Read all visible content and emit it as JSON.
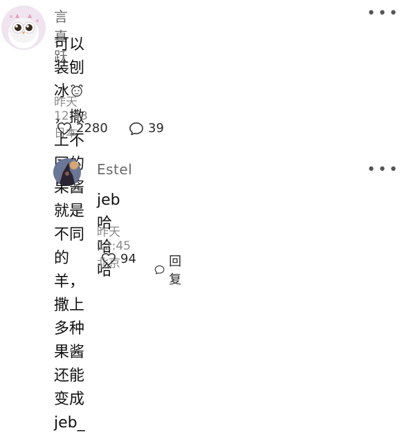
{
  "comments": [
    {
      "username": "言真跃",
      "content_part1": "可以装刨冰",
      "content_part2": "，撒上不同的果酱就是不同的",
      "content_line2": "羊，撒上多种果酱还能变成jeb_",
      "meta": "昨天 12:43 日本",
      "likes": "2280",
      "replies": "39"
    },
    {
      "username": "Estel",
      "content": "jeb哈哈哈",
      "meta": "昨天 12:45 北京",
      "likes": "94",
      "reply_label": "回复"
    }
  ],
  "icons": {
    "more": "more-horizontal-icon",
    "like": "heart-outline-icon",
    "comment": "speech-bubble-icon",
    "inline_emoji": "sheep-face-emoji-icon"
  },
  "colors": {
    "text_primary": "#111111",
    "text_secondary": "#8a8a8a",
    "username": "#6b6b6b"
  }
}
